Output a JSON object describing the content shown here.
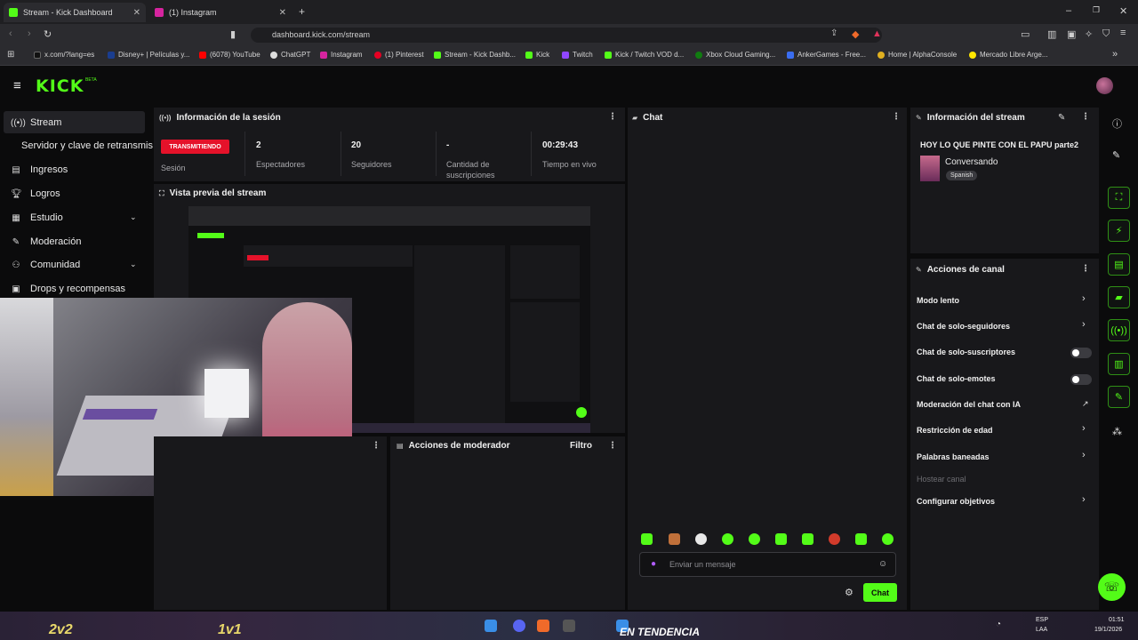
{
  "browser": {
    "tabs": [
      {
        "title": "Stream - Kick Dashboard",
        "active": true,
        "icon": "kick-icon"
      },
      {
        "title": "(1) Instagram",
        "active": false,
        "icon": "instagram-icon"
      }
    ],
    "new_tab": "+",
    "url": "dashboard.kick.com/stream",
    "bookmarks": [
      {
        "label": "x.com/?lang=es",
        "color": "#111111"
      },
      {
        "label": "Disney+ | Películas y...",
        "color": "#1a3d8f"
      },
      {
        "label": "(6078) YouTube",
        "color": "#ff0000"
      },
      {
        "label": "ChatGPT",
        "color": "#ffffff"
      },
      {
        "label": "Instagram",
        "color": "#d6249f"
      },
      {
        "label": "(1) Pinterest",
        "color": "#e60023"
      },
      {
        "label": "Stream - Kick Dashb...",
        "color": "#53fc18"
      },
      {
        "label": "Kick",
        "color": "#53fc18"
      },
      {
        "label": "Twitch",
        "color": "#9146ff"
      },
      {
        "label": "Kick / Twitch VOD d...",
        "color": "#53fc18"
      },
      {
        "label": "Xbox Cloud Gaming...",
        "color": "#107c10"
      },
      {
        "label": "AnkerGames - Free...",
        "color": "#3a6df0"
      },
      {
        "label": "Home | AlphaConsole",
        "color": "#e0b020"
      },
      {
        "label": "Mercado Libre Arge...",
        "color": "#ffe600"
      }
    ]
  },
  "app": {
    "logo": "KICK",
    "beta": "BETA"
  },
  "sidebar": {
    "items": [
      {
        "label": "Stream",
        "icon": "broadcast-icon",
        "active": true
      },
      {
        "label": "Servidor y clave de retransmisión",
        "icon": "",
        "active": false
      },
      {
        "label": "Ingresos",
        "icon": "chart-icon",
        "active": false
      },
      {
        "label": "Logros",
        "icon": "trophy-icon",
        "active": false
      },
      {
        "label": "Estudio",
        "icon": "studio-icon",
        "active": false
      },
      {
        "label": "Moderación",
        "icon": "wrench-icon",
        "active": false
      },
      {
        "label": "Comunidad",
        "icon": "community-icon",
        "active": false
      },
      {
        "label": "Drops y recompensas",
        "icon": "gift-icon",
        "active": false
      }
    ]
  },
  "session": {
    "title": "Información de la sesión",
    "status_badge": "TRANSMITIENDO",
    "status_label": "Sesión",
    "viewers_value": "2",
    "viewers_label": "Espectadores",
    "followers_value": "20",
    "followers_label": "Seguidores",
    "subs_value": "-",
    "subs_label": "Cantidad de suscripciones",
    "uptime_value": "00:29:43",
    "uptime_label": "Tiempo en vivo"
  },
  "preview": {
    "title": "Vista previa del stream"
  },
  "mod_actions": {
    "title": "Acciones de moderador",
    "filter": "Filtro"
  },
  "chat": {
    "title": "Chat",
    "input_placeholder": "Enviar un mensaje",
    "send_label": "Chat",
    "emote_colors": [
      "#53fc18",
      "#c0703a",
      "#e8e8e8",
      "#53fc18",
      "#53fc18",
      "#53fc18",
      "#53fc18",
      "#d23b2b",
      "#53fc18",
      "#53fc18"
    ]
  },
  "stream_info": {
    "title": "Información del stream",
    "stream_title": "HOY LO QUE PINTE CON EL PAPU parte2",
    "category": "Conversando",
    "language": "Spanish"
  },
  "channel_actions": {
    "title": "Acciones de canal",
    "items": [
      {
        "label": "Modo lento",
        "control": "chevron"
      },
      {
        "label": "Chat de solo-seguidores",
        "control": "chevron"
      },
      {
        "label": "Chat de solo-suscriptores",
        "control": "toggle"
      },
      {
        "label": "Chat de solo-emotes",
        "control": "toggle"
      },
      {
        "label": "Moderación del chat con IA",
        "control": "external"
      },
      {
        "label": "Restricción de edad",
        "control": "chevron"
      },
      {
        "label": "Palabras baneadas",
        "control": "chevron"
      },
      {
        "label": "Hostear canal",
        "control": "none"
      },
      {
        "label": "Configurar objetivos",
        "control": "chevron"
      }
    ]
  },
  "taskbar": {
    "lang": "ESP",
    "region": "LAA",
    "time": "01:51",
    "date": "19/1/2026",
    "banner": "EN TENDENCIA",
    "game1": "2v2",
    "game2": "1v1"
  },
  "colors": {
    "accent": "#53fc18",
    "live": "#e5122a",
    "panel": "#18181b",
    "background": "#0b0b0c"
  }
}
